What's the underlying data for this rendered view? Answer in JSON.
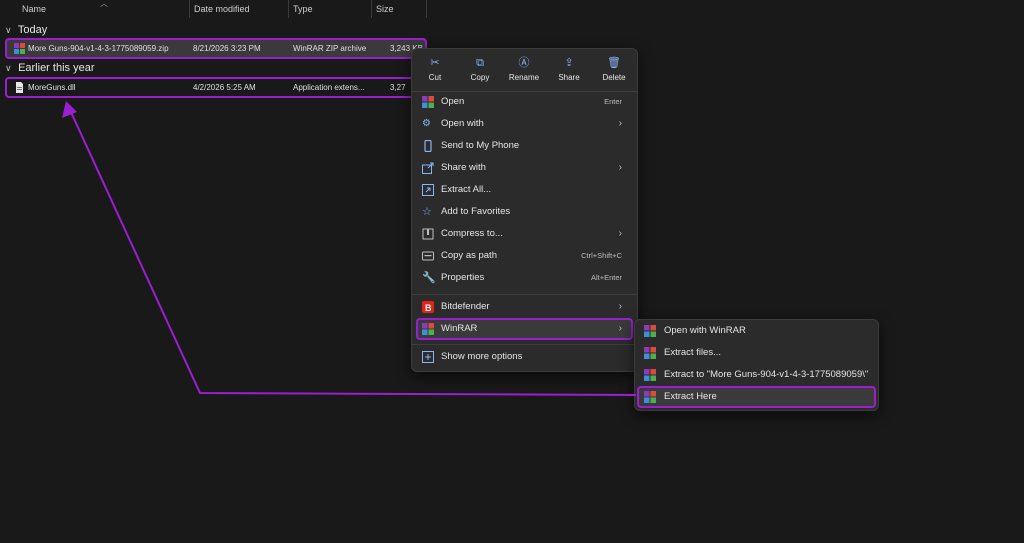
{
  "columns": {
    "name": "Name",
    "date_modified": "Date modified",
    "type": "Type",
    "size": "Size"
  },
  "groups": {
    "today": "Today",
    "earlier": "Earlier this year"
  },
  "files": [
    {
      "name": "More Guns-904-v1-4-3-1775089059.zip",
      "date": "8/21/2026 3:23 PM",
      "type": "WinRAR ZIP archive",
      "size": "3,243 KB",
      "icon": "winrar-archive-icon"
    },
    {
      "name": "MoreGuns.dll",
      "date": "4/2/2026 5:25 AM",
      "type": "Application extens...",
      "size": "3,27",
      "icon": "dll-file-icon"
    }
  ],
  "context_menu": {
    "toolbar": [
      {
        "label": "Cut",
        "icon": "scissors-icon"
      },
      {
        "label": "Copy",
        "icon": "copy-icon"
      },
      {
        "label": "Rename",
        "icon": "rename-icon"
      },
      {
        "label": "Share",
        "icon": "share-icon"
      },
      {
        "label": "Delete",
        "icon": "trash-icon"
      }
    ],
    "items": [
      {
        "label": "Open",
        "shortcut": "Enter",
        "icon": "winrar-icon"
      },
      {
        "label": "Open with",
        "submenu": true,
        "icon": "open-with-icon"
      },
      {
        "label": "Send to My Phone",
        "icon": "phone-icon"
      },
      {
        "label": "Share with",
        "submenu": true,
        "icon": "share-with-icon"
      },
      {
        "label": "Extract All...",
        "icon": "extract-all-icon"
      },
      {
        "label": "Add to Favorites",
        "icon": "star-icon"
      },
      {
        "label": "Compress to...",
        "submenu": true,
        "icon": "compress-icon"
      },
      {
        "label": "Copy as path",
        "shortcut": "Ctrl+Shift+C",
        "icon": "copy-path-icon"
      },
      {
        "label": "Properties",
        "shortcut": "Alt+Enter",
        "icon": "wrench-icon"
      },
      {
        "label": "Bitdefender",
        "submenu": true,
        "icon": "bitdefender-icon"
      },
      {
        "label": "WinRAR",
        "submenu": true,
        "icon": "winrar-icon"
      },
      {
        "label": "Show more options",
        "icon": "more-options-icon"
      }
    ]
  },
  "winrar_submenu": [
    {
      "label": "Open with WinRAR",
      "icon": "winrar-icon"
    },
    {
      "label": "Extract files...",
      "icon": "winrar-icon"
    },
    {
      "label": "Extract to \"More Guns-904-v1-4-3-1775089059\\\"",
      "icon": "winrar-icon"
    },
    {
      "label": "Extract Here",
      "icon": "winrar-icon"
    }
  ],
  "colors": {
    "background": "#191919",
    "menu_bg": "#2b2b2b",
    "highlight": "#9b1fd1",
    "accent_icon": "#8ab4f8",
    "bitdefender": "#e2231a"
  }
}
